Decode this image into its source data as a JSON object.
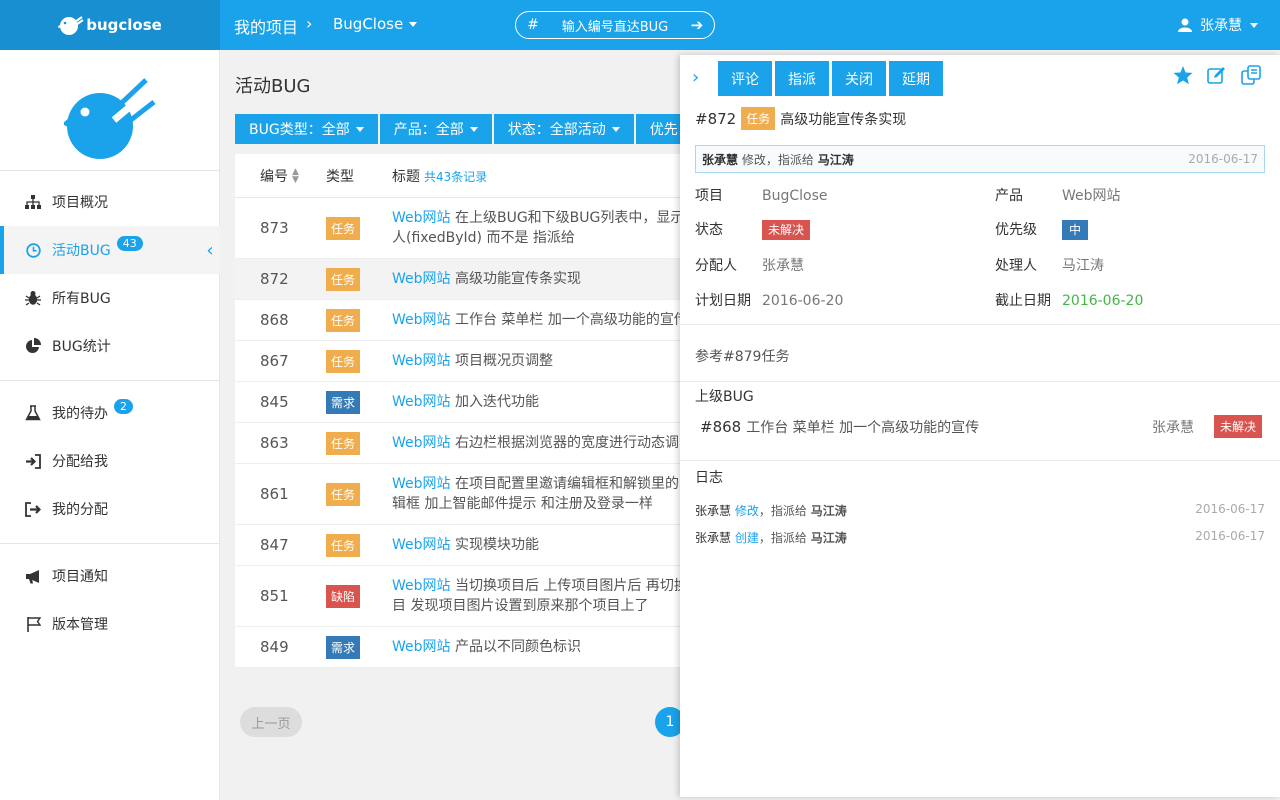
{
  "topbar": {
    "brand": "bugclose",
    "crumb_title": "我的项目",
    "crumb_sep": "›",
    "project": "BugClose",
    "jump_placeholder": "输入编号直达BUG",
    "jump_hash": "#",
    "jump_arrow": "➔",
    "user": "张承慧"
  },
  "sidebar": {
    "items": [
      {
        "label": "项目概况",
        "icon": "sitemap-icon"
      },
      {
        "label": "活动BUG",
        "icon": "clock-icon",
        "badge": "43",
        "active": true
      },
      {
        "label": "所有BUG",
        "icon": "bug-icon"
      },
      {
        "label": "BUG统计",
        "icon": "pie-chart-icon"
      },
      {
        "label": "我的待办",
        "icon": "flask-icon",
        "badge": "2"
      },
      {
        "label": "分配给我",
        "icon": "sign-in-icon"
      },
      {
        "label": "我的分配",
        "icon": "sign-out-icon"
      },
      {
        "label": "项目通知",
        "icon": "bullhorn-icon"
      },
      {
        "label": "版本管理",
        "icon": "flag-icon"
      }
    ],
    "collapse": "‹"
  },
  "main": {
    "title": "活动BUG",
    "filters": [
      "BUG类型：全部",
      "产品：全部",
      "状态：全部活动",
      "优先"
    ],
    "columns": {
      "id": "编号",
      "type": "类型",
      "title": "标题",
      "count": "共43条记录"
    },
    "rows": [
      {
        "id": "873",
        "type": "任务",
        "product": "Web网站",
        "text": "在上级BUG和下级BUG列表中，显示",
        "text2": "人(fixedById) 而不是 指派给"
      },
      {
        "id": "872",
        "type": "任务",
        "product": "Web网站",
        "text": "高级功能宣传条实现"
      },
      {
        "id": "868",
        "type": "任务",
        "product": "Web网站",
        "text": "工作台 菜单栏 加一个高级功能的宣传"
      },
      {
        "id": "867",
        "type": "任务",
        "product": "Web网站",
        "text": "项目概况页调整"
      },
      {
        "id": "845",
        "type": "需求",
        "product": "Web网站",
        "text": "加入迭代功能"
      },
      {
        "id": "863",
        "type": "任务",
        "product": "Web网站",
        "text": "右边栏根据浏览器的宽度进行动态调"
      },
      {
        "id": "861",
        "type": "任务",
        "product": "Web网站",
        "text": "在项目配置里邀请编辑框和解锁里的",
        "text2": "辑框 加上智能邮件提示 和注册及登录一样"
      },
      {
        "id": "847",
        "type": "任务",
        "product": "Web网站",
        "text": "实现模块功能"
      },
      {
        "id": "851",
        "type": "缺陷",
        "product": "Web网站",
        "text": "当切换项目后 上传项目图片后 再切换",
        "text2": "目 发现项目图片设置到原来那个项目上了"
      },
      {
        "id": "849",
        "type": "需求",
        "product": "Web网站",
        "text": "产品以不同颜色标识"
      }
    ],
    "pager": {
      "prev": "上一页",
      "current": "1"
    }
  },
  "panel": {
    "back": "›",
    "actions": [
      "评论",
      "指派",
      "关闭",
      "延期"
    ],
    "tools": [
      "star-icon",
      "edit-icon",
      "copy-icon"
    ],
    "id": "#872",
    "type": "任务",
    "title": "高级功能宣传条实现",
    "note": {
      "user": "张承慧",
      "action": "修改，指派给",
      "assignee": "马江涛",
      "date": "2016-06-17"
    },
    "fields": {
      "project_label": "项目",
      "project": "BugClose",
      "product_label": "产品",
      "product": "Web网站",
      "status_label": "状态",
      "status": "未解决",
      "priority_label": "优先级",
      "priority": "中",
      "assigner_label": "分配人",
      "assigner": "张承慧",
      "handler_label": "处理人",
      "handler": "马江涛",
      "plan_label": "计划日期",
      "plan": "2016-06-20",
      "due_label": "截止日期",
      "due": "2016-06-20"
    },
    "description": "参考#879任务",
    "parent_label": "上级BUG",
    "parent": {
      "id": "#868",
      "title": "工作台 菜单栏 加一个高级功能的宣传",
      "user": "张承慧",
      "status": "未解决"
    },
    "log_label": "日志",
    "logs": [
      {
        "user": "张承慧",
        "verb": "修改",
        "rest": "，指派给",
        "target": "马江涛",
        "date": "2016-06-17"
      },
      {
        "user": "张承慧",
        "verb": "创建",
        "rest": "，指派给",
        "target": "马江涛",
        "date": "2016-06-17"
      }
    ]
  },
  "colors": {
    "accent": "#1aa3ea",
    "brand_dark": "#178fd0",
    "task": "#f0ad4e",
    "requirement": "#337ab7",
    "defect": "#d9534f",
    "green": "#44b549"
  }
}
